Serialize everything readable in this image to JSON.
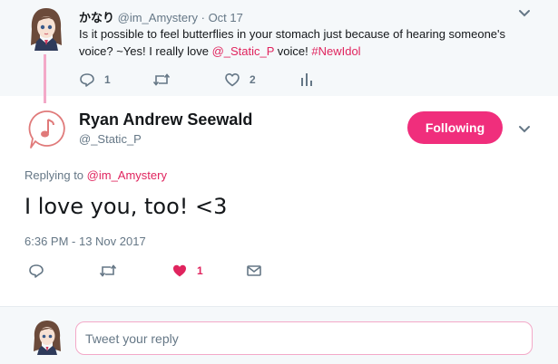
{
  "parent_tweet": {
    "name": "かなり",
    "handle": "@im_Amystery",
    "separator": "·",
    "date": "Oct 17",
    "text_part1": "Is it possible to feel butterflies in your stomach just because of hearing someone's voice? ~Yes! I really love ",
    "mention": "@_Static_P",
    "text_part2": " voice! ",
    "hashtag": "#NewIdol",
    "reply_count": "1",
    "like_count": "2",
    "icons": [
      "reply-icon",
      "retweet-icon",
      "heart-icon",
      "analytics-icon",
      "chevron-down-icon"
    ]
  },
  "main_tweet": {
    "name": "Ryan Andrew Seewald",
    "handle": "@_Static_P",
    "follow_label": "Following",
    "replying_prefix": "Replying to ",
    "replying_handle": "@im_Amystery",
    "text": "I love you, too! <3",
    "timestamp": "6:36 PM - 13 Nov 2017",
    "like_count": "1",
    "icons": [
      "music-note-avatar-icon",
      "reply-icon",
      "retweet-icon",
      "heart-filled-icon",
      "mail-icon",
      "chevron-down-icon"
    ]
  },
  "reply_box": {
    "placeholder": "Tweet your reply"
  },
  "colors": {
    "accent": "#f02e7c",
    "link": "#e0245e",
    "muted": "#657786",
    "thread_line": "#f3a9c8",
    "background_alt": "#f5f8fa"
  }
}
